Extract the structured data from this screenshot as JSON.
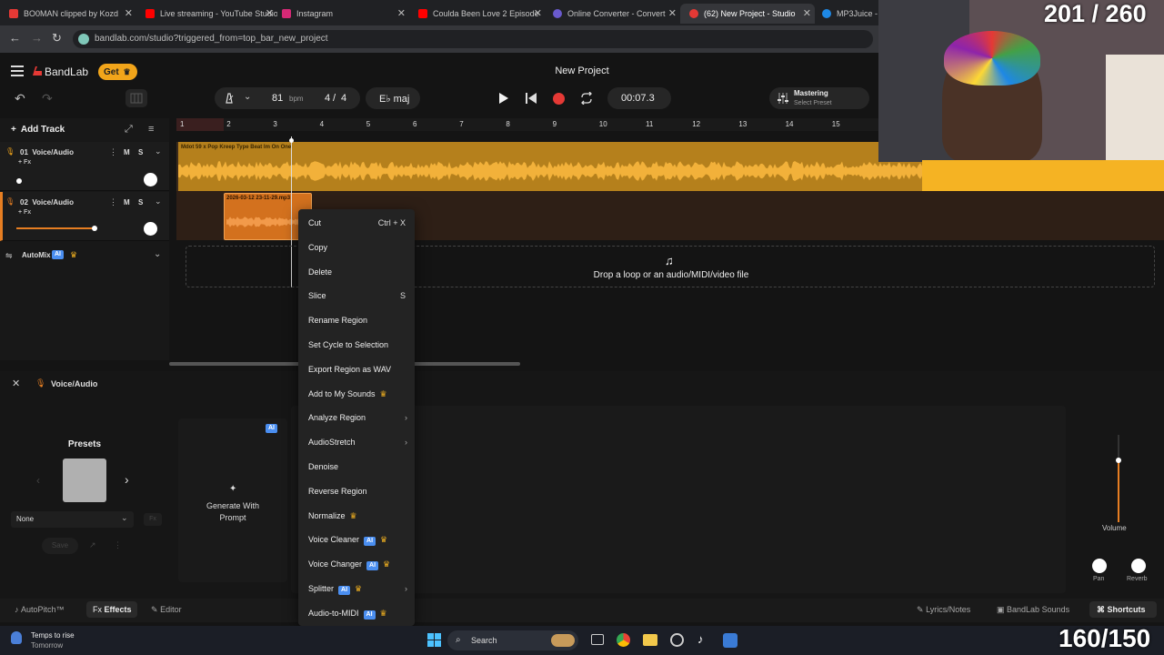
{
  "browser": {
    "tabs": [
      {
        "title": "BO0MAN clipped by Kozd",
        "color": "#e53935"
      },
      {
        "title": "Live streaming - YouTube Studio",
        "color": "#ff0000"
      },
      {
        "title": "Instagram",
        "color": "#d62976"
      },
      {
        "title": "Coulda Been Love 2 Episode",
        "color": "#ff0000"
      },
      {
        "title": "Online Converter - Convert",
        "color": "#6a5acd"
      },
      {
        "title": "(62) New Project - Studio",
        "color": "#e53935"
      },
      {
        "title": "MP3Juice - Fr",
        "color": "#1e88e5"
      }
    ],
    "url": "bandlab.com/studio?triggered_from=top_bar_new_project"
  },
  "app": {
    "logo": "BandLab",
    "get_label": "Get",
    "project_title": "New Project",
    "bpm_value": "81",
    "bpm_label": "bpm",
    "time_sig_num": "4",
    "time_sig_sep": "/",
    "time_sig_den": "4",
    "key": "E♭ maj",
    "time": "00:07.3",
    "mastering_label": "Mastering",
    "mastering_preset": "Select Preset"
  },
  "tracks_panel": {
    "add_track": "Add Track",
    "tracks": [
      {
        "number": "01",
        "name": "Voice/Audio",
        "fx": "+ Fx",
        "mute": "M",
        "solo": "S"
      },
      {
        "number": "02",
        "name": "Voice/Audio",
        "fx": "+ Fx",
        "mute": "M",
        "solo": "S"
      }
    ],
    "automix": "AutoMix",
    "ai_badge": "AI"
  },
  "ruler": [
    "1",
    "2",
    "3",
    "4",
    "5",
    "6",
    "7",
    "8",
    "9",
    "10",
    "11",
    "12",
    "13",
    "14",
    "15"
  ],
  "regions": {
    "region1_name": "Mdot 59 x Pop Kreep Type Beat Im On One",
    "region2_name": "2026-03-12 23-11-29.mp3"
  },
  "drop_zone": "Drop a loop or an audio/MIDI/video file",
  "context_menu": [
    {
      "label": "Cut",
      "shortcut": "Ctrl + X"
    },
    {
      "label": "Copy"
    },
    {
      "label": "Delete"
    },
    {
      "label": "Slice",
      "shortcut": "S"
    },
    {
      "label": "Rename Region"
    },
    {
      "label": "Set Cycle to Selection"
    },
    {
      "label": "Export Region as WAV"
    },
    {
      "label": "Add to My Sounds",
      "crown": true
    },
    {
      "label": "Analyze Region",
      "submenu": true
    },
    {
      "label": "AudioStretch",
      "submenu": true
    },
    {
      "label": "Denoise"
    },
    {
      "label": "Reverse Region"
    },
    {
      "label": "Normalize",
      "crown": true
    },
    {
      "label": "Voice Cleaner",
      "ai": true,
      "crown": true
    },
    {
      "label": "Voice Changer",
      "ai": true,
      "crown": true
    },
    {
      "label": "Splitter",
      "ai": true,
      "crown": true,
      "submenu": true
    },
    {
      "label": "Audio-to-MIDI",
      "ai": true,
      "crown": true
    }
  ],
  "effects_panel": {
    "header": "Voice/Audio",
    "presets_label": "Presets",
    "preset_value": "None",
    "save_label": "Save",
    "ai_badge": "AI",
    "generate_label": "Generate With Prompt",
    "volume_label": "Volume",
    "pan_label": "Pan",
    "reverb_label": "Reverb"
  },
  "bottom_bar": {
    "autopitch": "AutoPitch™",
    "effects": "Effects",
    "editor": "Editor",
    "lyrics": "Lyrics/Notes",
    "sounds": "BandLab Sounds",
    "shortcuts": "Shortcuts"
  },
  "taskbar": {
    "weather_line1": "Temps to rise",
    "weather_line2": "Tomorrow",
    "search": "Search"
  },
  "overlays": {
    "top_counter": "201 / 260",
    "bottom_counter": "160/150"
  },
  "colors": {
    "accent_orange": "#f2a51a",
    "region_orange": "#e67e22",
    "record_red": "#e53935",
    "ai_blue": "#4a8ef0"
  }
}
